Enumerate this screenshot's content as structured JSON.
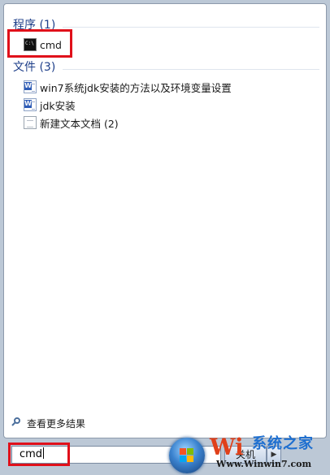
{
  "programs": {
    "header": "程序 (1)",
    "items": [
      {
        "label": "cmd",
        "icon": "cmd-icon"
      }
    ]
  },
  "files": {
    "header": "文件 (3)",
    "items": [
      {
        "label": "win7系统jdk安装的方法以及环境变量设置",
        "icon": "word-document-icon"
      },
      {
        "label": "jdk安装",
        "icon": "word-document-icon"
      },
      {
        "label": "新建文本文档 (2)",
        "icon": "text-document-icon"
      }
    ]
  },
  "see_more": {
    "label": "查看更多结果",
    "icon": "search-icon"
  },
  "search": {
    "value": "cmd"
  },
  "shutdown": {
    "label": "关机",
    "arrow": "▶"
  },
  "watermark": {
    "logo": "Wi",
    "brand": "系统之家",
    "url": "Www.Winwin7.com"
  },
  "colors": {
    "header_text": "#1e3f8a",
    "highlight": "#e0101a",
    "watermark_brand": "#1e6fd0"
  }
}
